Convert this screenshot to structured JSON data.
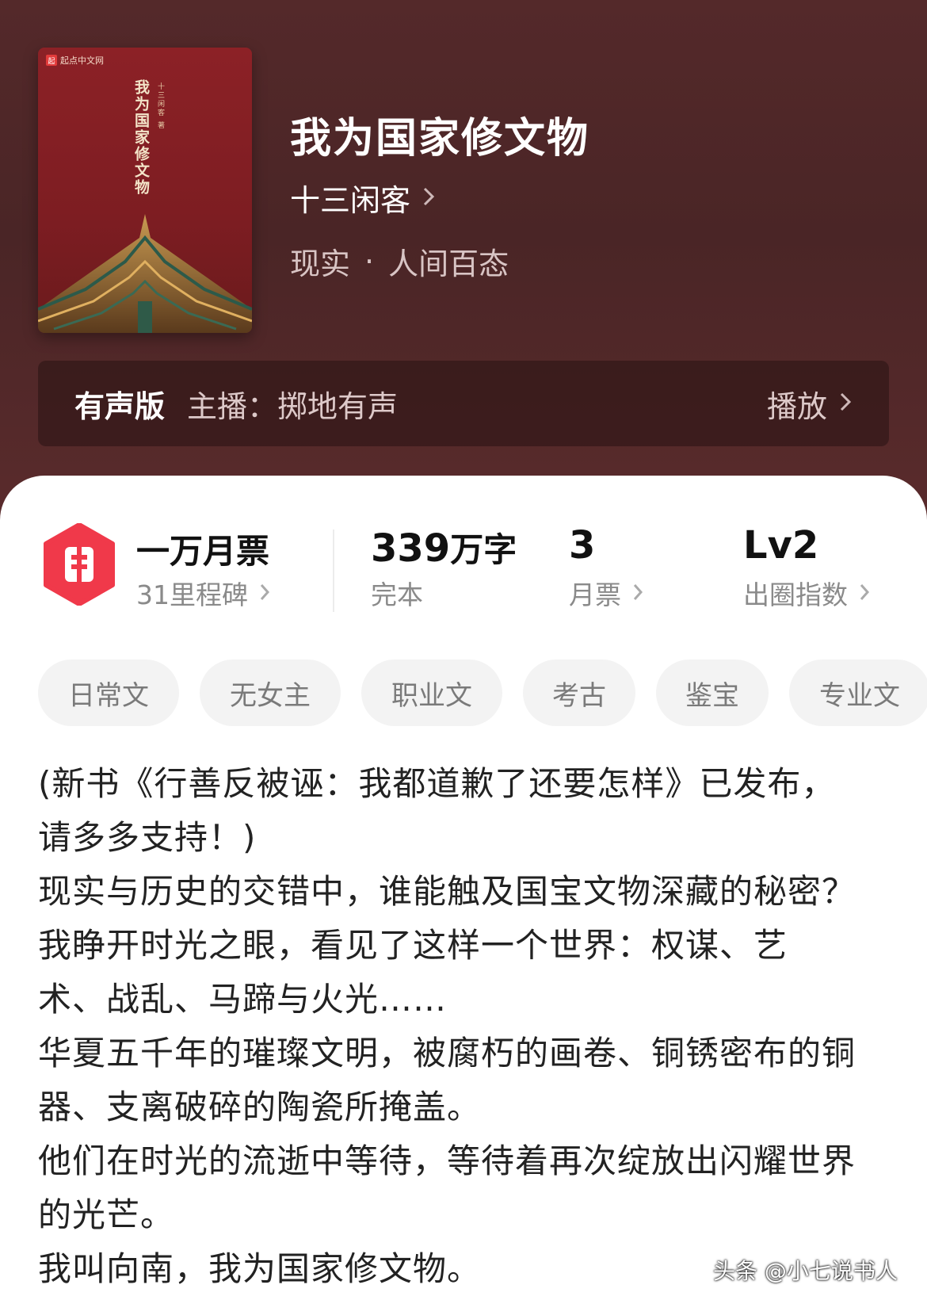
{
  "book": {
    "title": "我为国家修文物",
    "author": "十三闲客",
    "genre": "现实",
    "subgenre": "人间百态",
    "separator": "·"
  },
  "cover": {
    "brand": "起点中文网",
    "brand_mark": "起",
    "title": "我为国家修文物",
    "author": "十三闲客 著"
  },
  "audio": {
    "label": "有声版",
    "host": "主播：掷地有声",
    "play_label": "播放"
  },
  "stats": {
    "ticket_title": "一万月票",
    "milestone": "31里程碑",
    "word_count": "339",
    "word_unit": "万字",
    "status": "完本",
    "monthly_votes": "3",
    "monthly_votes_label": "月票",
    "level": "Lv2",
    "level_label": "出圈指数"
  },
  "tags": [
    "日常文",
    "无女主",
    "职业文",
    "考古",
    "鉴宝",
    "专业文"
  ],
  "description": [
    "(新书《行善反被诬：我都道歉了还要怎样》已发布，",
    "请多多支持！)",
    "现实与历史的交错中，谁能触及国宝文物深藏的秘密？",
    "我睁开时光之眼，看见了这样一个世界：权谋、艺",
    "术、战乱、马蹄与火光……",
    "华夏五千年的璀璨文明，被腐朽的画卷、铜锈密布的铜",
    "器、支离破碎的陶瓷所掩盖。",
    "他们在时光的流逝中等待，等待着再次绽放出闪耀世界",
    "的光芒。",
    "我叫向南，我为国家修文物。"
  ],
  "watermark": "头条 @小七说书人",
  "colors": {
    "header_bg": "#4f2728",
    "cover_red": "#8c2126",
    "badge_red": "#f0394a",
    "text_dark": "#222222",
    "text_muted": "#8a8a8a",
    "tag_bg": "#f3f3f3"
  }
}
